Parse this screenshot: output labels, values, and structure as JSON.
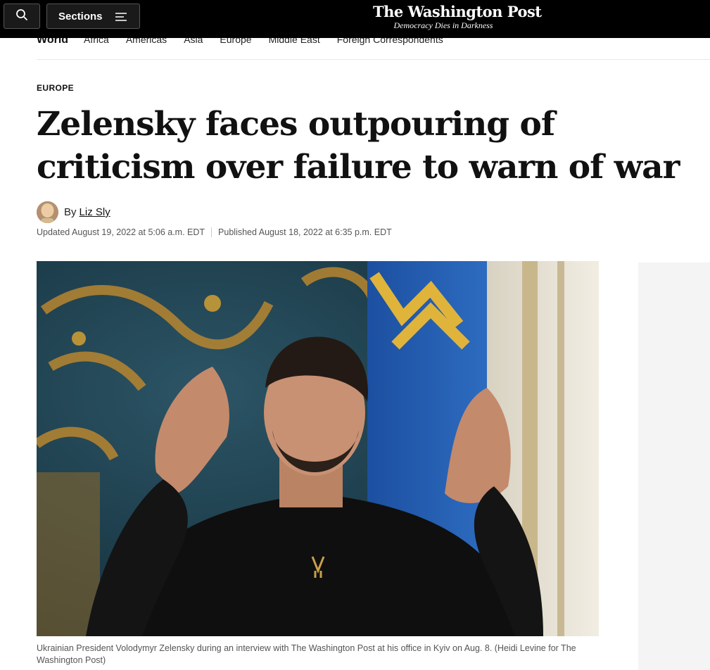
{
  "header": {
    "search_icon": "search-icon",
    "sections_label": "Sections",
    "menu_icon": "hamburger-icon",
    "logo": "The Washington Post",
    "tagline": "Democracy Dies in Darkness",
    "colors": {
      "bar": "#000000",
      "text": "#ffffff"
    }
  },
  "subnav": {
    "title": "World",
    "items": [
      "Africa",
      "Americas",
      "Asia",
      "Europe",
      "Middle East",
      "Foreign Correspondents"
    ]
  },
  "article": {
    "kicker": "EUROPE",
    "headline": "Zelensky faces outpouring of criticism over failure to warn of war",
    "by_label": "By",
    "author": "Liz Sly",
    "updated": "Updated August 19, 2022 at 5:06 a.m. EDT",
    "published": "Published August 18, 2022 at 6:35 p.m. EDT",
    "caption": "Ukrainian President Volodymyr Zelensky during an interview with The Washington Post at his office in Kyiv on Aug. 8. (Heidi Levine for The Washington Post)"
  }
}
